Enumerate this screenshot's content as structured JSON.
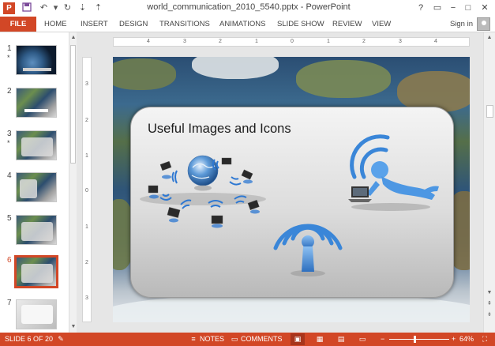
{
  "titlebar": {
    "title": "world_communication_2010_5540.pptx - PowerPoint",
    "app_icon": "P",
    "icons": [
      "save-icon",
      "undo-icon",
      "redo-icon",
      "customize-qat-icon"
    ],
    "window_controls": {
      "help": "?",
      "restore_ribbon": "▭",
      "minimize": "−",
      "maximize": "□",
      "close": "✕"
    }
  },
  "ribbon": {
    "tabs": [
      "FILE",
      "HOME",
      "INSERT",
      "DESIGN",
      "TRANSITIONS",
      "ANIMATIONS",
      "SLIDE SHOW",
      "REVIEW",
      "VIEW"
    ],
    "signin": "Sign in"
  },
  "rulers": {
    "horizontal": [
      "4",
      "3",
      "2",
      "1",
      "0",
      "1",
      "2",
      "3",
      "4"
    ],
    "vertical": [
      "3",
      "2",
      "1",
      "0",
      "1",
      "2",
      "3"
    ]
  },
  "thumbnails": [
    {
      "num": "1",
      "star": "*"
    },
    {
      "num": "2",
      "star": ""
    },
    {
      "num": "3",
      "star": "*"
    },
    {
      "num": "4",
      "star": ""
    },
    {
      "num": "5",
      "star": ""
    },
    {
      "num": "6",
      "star": "",
      "active": true
    },
    {
      "num": "7",
      "star": ""
    }
  ],
  "slide": {
    "title": "Useful Images and Icons"
  },
  "statusbar": {
    "slide_info": "SLIDE 6 OF 20",
    "notes": "NOTES",
    "comments": "COMMENTS",
    "zoom": "64%",
    "zoom_minus": "−",
    "zoom_plus": "+",
    "zoom_level": 0.64
  },
  "colors": {
    "accent": "#d24726",
    "bubble_blue": "#4a90d9"
  }
}
